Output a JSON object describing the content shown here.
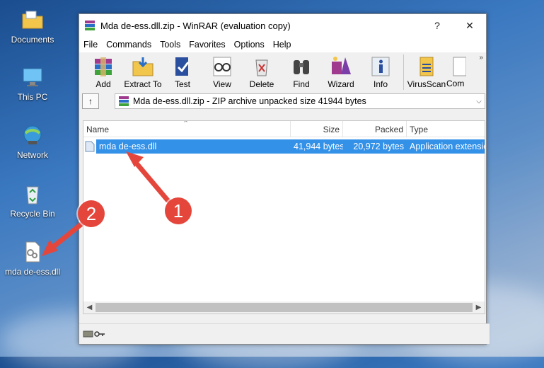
{
  "desktop": {
    "icons": [
      {
        "label": "Documents"
      },
      {
        "label": "This PC"
      },
      {
        "label": "Network"
      },
      {
        "label": "Recycle Bin"
      },
      {
        "label": "mda de-ess.dll"
      }
    ]
  },
  "window": {
    "title": "Mda de-ess.dll.zip - WinRAR (evaluation copy)",
    "help_glyph": "?",
    "close_glyph": "✕",
    "menu": [
      "File",
      "Commands",
      "Tools",
      "Favorites",
      "Options",
      "Help"
    ],
    "toolbar": [
      "Add",
      "Extract To",
      "Test",
      "View",
      "Delete",
      "Find",
      "Wizard",
      "Info",
      "VirusScan",
      "Com"
    ],
    "toolbar_more": "»",
    "address": {
      "text": "Mda de-ess.dll.zip - ZIP archive unpacked size 41944 bytes",
      "dropdown": "⌵",
      "up_glyph": "↑"
    },
    "columns": [
      "Name",
      "Size",
      "Packed",
      "Type"
    ],
    "sort_glyph": "⌃",
    "files": [
      {
        "name": "mda de-ess.dll",
        "size": "41,944 bytes",
        "packed": "20,972 bytes",
        "type": "Application extension"
      }
    ]
  },
  "annotations": {
    "badge1": "1",
    "badge2": "2",
    "color": "#e5463b"
  }
}
